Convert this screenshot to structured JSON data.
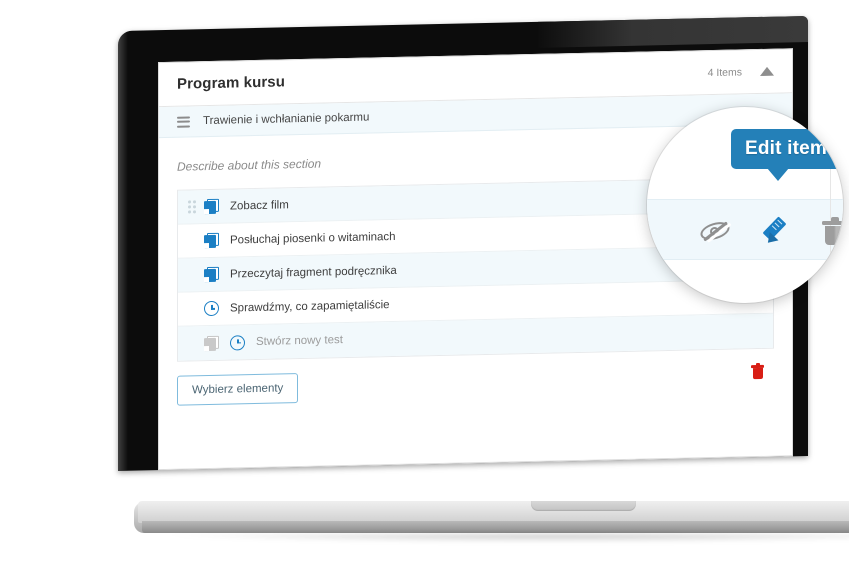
{
  "panel": {
    "title": "Program kursu",
    "items_count": "4 Items",
    "collapse_icon": "triangle-up-icon",
    "section": {
      "drag_icon": "hamburger-icon",
      "label": "Trawienie i wchłanianie pokarmu"
    },
    "description_placeholder": "Describe about this section",
    "items": [
      {
        "icon": "book-icon",
        "label": "Zobacz film",
        "muted": false,
        "striped": true,
        "has_drag_handle": true
      },
      {
        "icon": "book-icon",
        "label": "Posłuchaj piosenki o witaminach",
        "muted": false,
        "striped": false,
        "has_drag_handle": false
      },
      {
        "icon": "book-icon",
        "label": "Przeczytaj fragment podręcznika",
        "muted": false,
        "striped": true,
        "has_drag_handle": false
      },
      {
        "icon": "clock-icon",
        "label": "Sprawdźmy, co zapamiętaliście",
        "muted": false,
        "striped": false,
        "has_drag_handle": false
      },
      {
        "icon": "book-clock-icon",
        "label": "Stwórz nowy test",
        "muted": true,
        "striped": true,
        "has_drag_handle": false
      }
    ],
    "footer": {
      "pick_button_label": "Wybierz elementy",
      "delete_icon": "trash-icon-red"
    }
  },
  "magnifier": {
    "tooltip_label": "Edit item",
    "actions": [
      {
        "icon": "eye-slash-icon",
        "name": "toggle-visibility"
      },
      {
        "icon": "pencil-icon",
        "name": "edit-item"
      },
      {
        "icon": "trash-icon",
        "name": "delete-item"
      }
    ]
  },
  "colors": {
    "accent_blue": "#1b7fc4",
    "tooltip_blue": "#2480b8",
    "row_stripe": "#f2f9fc",
    "delete_red": "#d81e15",
    "icon_grey": "#9d9d9d"
  }
}
